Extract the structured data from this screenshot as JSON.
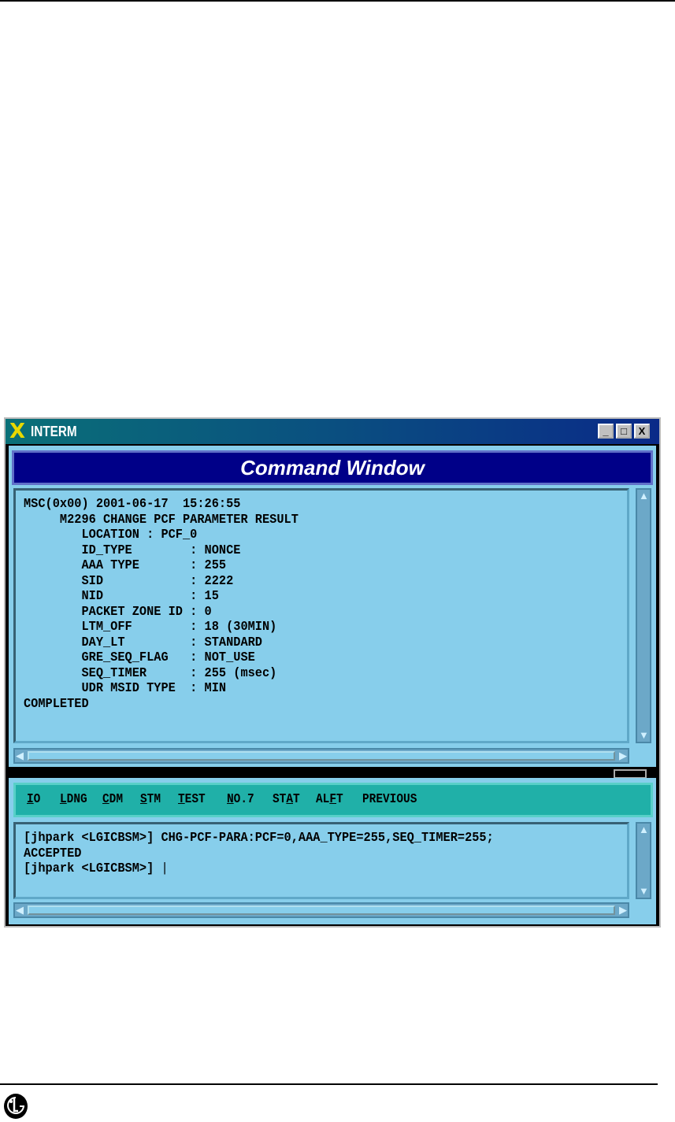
{
  "window": {
    "title": "INTERM",
    "header": "Command Window",
    "min": "_",
    "max": "□",
    "close": "X"
  },
  "output": {
    "lines": [
      "MSC(0x00) 2001-06-17  15:26:55",
      "     M2296 CHANGE PCF PARAMETER RESULT",
      "        LOCATION : PCF_0",
      "        ID_TYPE        : NONCE",
      "        AAA TYPE       : 255",
      "        SID            : 2222",
      "        NID            : 15",
      "        PACKET ZONE ID : 0",
      "        LTM_OFF        : 18 (30MIN)",
      "        DAY_LT         : STANDARD",
      "        GRE_SEQ_FLAG   : NOT_USE",
      "        SEQ_TIMER      : 255 (msec)",
      "        UDR MSID TYPE  : MIN",
      "COMPLETED"
    ]
  },
  "menu": [
    {
      "pre": "",
      "u": "I",
      "post": "O"
    },
    {
      "pre": "",
      "u": "L",
      "post": "DNG"
    },
    {
      "pre": "",
      "u": "C",
      "post": "DM"
    },
    {
      "pre": "",
      "u": "S",
      "post": "TM"
    },
    {
      "pre": "",
      "u": "T",
      "post": "EST"
    },
    {
      "pre": "",
      "u": "N",
      "post": "O.7"
    },
    {
      "pre": "ST",
      "u": "A",
      "post": "T"
    },
    {
      "pre": "AL",
      "u": "F",
      "post": "T"
    },
    {
      "pre": "PREVIOUS",
      "u": "",
      "post": ""
    }
  ],
  "input": {
    "lines": [
      "[jhpark <LGICBSM>] CHG-PCF-PARA:PCF=0,AAA_TYPE=255,SEQ_TIMER=255;",
      "ACCEPTED",
      "[jhpark <LGICBSM>] "
    ]
  },
  "logo": "LG"
}
